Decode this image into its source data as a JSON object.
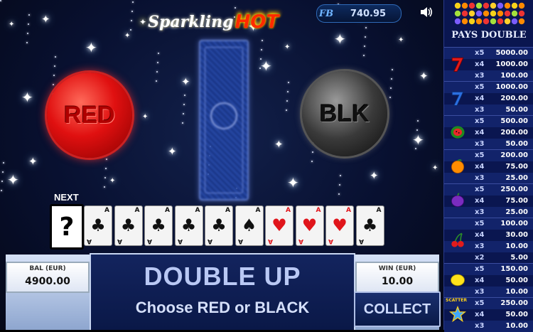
{
  "game": {
    "logo_word1": "Sparkling",
    "logo_word2": "HOT",
    "credit_value": "740.95",
    "credit_prefix": "FB"
  },
  "buttons": {
    "red_label": "RED",
    "black_label": "BLK"
  },
  "history": {
    "next_label": "NEXT",
    "next_card": "?",
    "cards": [
      {
        "rank": "A",
        "suit": "♣",
        "color": "black"
      },
      {
        "rank": "A",
        "suit": "♣",
        "color": "black"
      },
      {
        "rank": "A",
        "suit": "♣",
        "color": "black"
      },
      {
        "rank": "A",
        "suit": "♣",
        "color": "black"
      },
      {
        "rank": "A",
        "suit": "♣",
        "color": "black"
      },
      {
        "rank": "A",
        "suit": "♠",
        "color": "black"
      },
      {
        "rank": "A",
        "suit": "♥",
        "color": "red"
      },
      {
        "rank": "A",
        "suit": "♥",
        "color": "red"
      },
      {
        "rank": "A",
        "suit": "♥",
        "color": "red"
      },
      {
        "rank": "A",
        "suit": "♣",
        "color": "black"
      }
    ]
  },
  "panel": {
    "bal_label": "BAL (EUR)",
    "bal_value": "4900.00",
    "win_label": "WIN (EUR)",
    "win_value": "10.00",
    "title": "DOUBLE UP",
    "subtitle": "Choose RED or BLACK",
    "collect_label": "COLLECT"
  },
  "paytable": {
    "title": "PAYS DOUBLE",
    "scatter_label": "SCATTER",
    "symbols": [
      {
        "icon": "red-seven-icon",
        "rows": [
          [
            "x5",
            "5000.00"
          ],
          [
            "x4",
            "1000.00"
          ],
          [
            "x3",
            "100.00"
          ]
        ]
      },
      {
        "icon": "blue-seven-icon",
        "rows": [
          [
            "x5",
            "1000.00"
          ],
          [
            "x4",
            "200.00"
          ],
          [
            "x3",
            "50.00"
          ]
        ]
      },
      {
        "icon": "watermelon-icon",
        "rows": [
          [
            "x5",
            "500.00"
          ],
          [
            "x4",
            "200.00"
          ],
          [
            "x3",
            "50.00"
          ]
        ]
      },
      {
        "icon": "orange-icon",
        "rows": [
          [
            "x5",
            "200.00"
          ],
          [
            "x4",
            "75.00"
          ],
          [
            "x3",
            "25.00"
          ]
        ]
      },
      {
        "icon": "plum-icon",
        "rows": [
          [
            "x5",
            "250.00"
          ],
          [
            "x4",
            "75.00"
          ],
          [
            "x3",
            "25.00"
          ]
        ]
      },
      {
        "icon": "cherries-icon",
        "rows": [
          [
            "x5",
            "100.00"
          ],
          [
            "x4",
            "30.00"
          ],
          [
            "x3",
            "10.00"
          ],
          [
            "x2",
            "5.00"
          ]
        ]
      },
      {
        "icon": "lemon-icon",
        "rows": [
          [
            "x5",
            "150.00"
          ],
          [
            "x4",
            "50.00"
          ],
          [
            "x3",
            "10.00"
          ]
        ]
      },
      {
        "icon": "star-scatter-icon",
        "rows": [
          [
            "x5",
            "250.00"
          ],
          [
            "x4",
            "50.00"
          ],
          [
            "x3",
            "10.00"
          ]
        ]
      }
    ]
  },
  "colors": {
    "accent": "#0a1650",
    "red": "#e01010",
    "black": "#1a1a1a"
  }
}
